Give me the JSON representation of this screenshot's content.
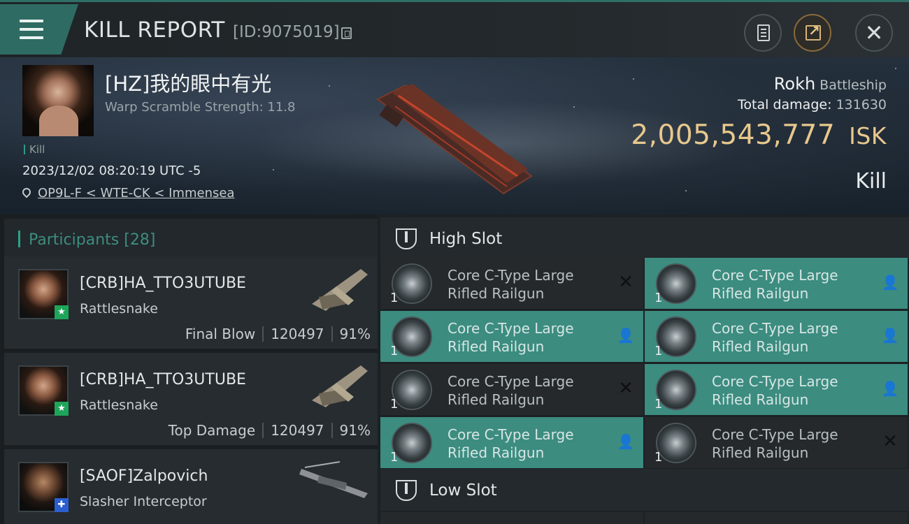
{
  "header": {
    "title": "KILL REPORT",
    "report_id": "[ID:9075019]"
  },
  "victim": {
    "name": "[HZ]我的眼中有光",
    "warp_scramble": "Warp Scramble Strength: 11.8",
    "kill_tag": "Kill",
    "datetime": "2023/12/02 08:20:19 UTC -5",
    "location": "OP9L-F < WTE-CK < Immensea",
    "ship_name": "Rokh",
    "ship_class": "Battleship",
    "total_damage_label": "Total damage:",
    "total_damage_value": "131630",
    "isk_value": "2,005,543,777",
    "isk_unit": "ISK",
    "result": "Kill"
  },
  "participants": {
    "label": "Participants",
    "count": "[28]",
    "items": [
      {
        "name": "[CRB]HA_TTO3UTUBE",
        "ship": "Rattlesnake",
        "role": "Final Blow",
        "damage": "120497",
        "percent": "91%",
        "badge": "★"
      },
      {
        "name": "[CRB]HA_TTO3UTUBE",
        "ship": "Rattlesnake",
        "role": "Top Damage",
        "damage": "120497",
        "percent": "91%",
        "badge": "★"
      },
      {
        "name": "[SAOF]Zalpovich",
        "ship": "Slasher Interceptor",
        "badge": "✚"
      }
    ]
  },
  "high_slot": {
    "label": "High Slot",
    "modules": [
      {
        "name": "Core C-Type Large",
        "name2": "Rifled Railgun",
        "qty": "1",
        "state": "destroyed"
      },
      {
        "name": "Core C-Type Large",
        "name2": "Rifled Railgun",
        "qty": "1",
        "state": "dropped"
      },
      {
        "name": "Core C-Type Large",
        "name2": "Rifled Railgun",
        "qty": "1",
        "state": "dropped"
      },
      {
        "name": "Core C-Type Large",
        "name2": "Rifled Railgun",
        "qty": "1",
        "state": "dropped"
      },
      {
        "name": "Core C-Type Large",
        "name2": "Rifled Railgun",
        "qty": "1",
        "state": "destroyed"
      },
      {
        "name": "Core C-Type Large",
        "name2": "Rifled Railgun",
        "qty": "1",
        "state": "dropped"
      },
      {
        "name": "Core C-Type Large",
        "name2": "Rifled Railgun",
        "qty": "1",
        "state": "dropped"
      },
      {
        "name": "Core C-Type Large",
        "name2": "Rifled Railgun",
        "qty": "1",
        "state": "destroyed"
      }
    ]
  },
  "low_slot": {
    "label": "Low Slot"
  },
  "icons": {
    "destroyed": "✕",
    "dropped": "👤"
  },
  "colors": {
    "accent_teal": "#3c8c80",
    "isk_gold": "#e8c88d"
  }
}
